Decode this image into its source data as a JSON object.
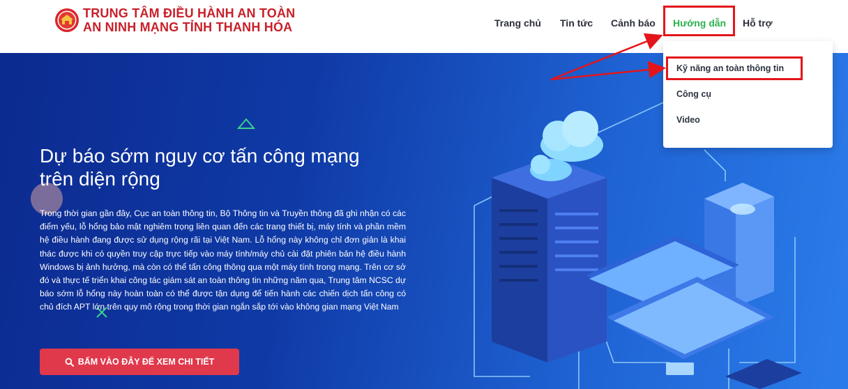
{
  "header": {
    "brand_line1": "TRUNG TÂM ĐIỀU HÀNH AN TOÀN",
    "brand_line2": "AN NINH MẠNG TỈNH THANH HÓA",
    "logo_icon": "thanh-hoa-emblem-icon"
  },
  "nav": {
    "items": [
      {
        "label": "Trang chủ"
      },
      {
        "label": "Tin tức"
      },
      {
        "label": "Cảnh báo"
      },
      {
        "label": "Hướng dẫn",
        "active": true
      },
      {
        "label": "Hỗ trợ"
      }
    ]
  },
  "dropdown": {
    "items": [
      {
        "label": "Kỹ năng an toàn thông tin"
      },
      {
        "label": "Công cụ"
      },
      {
        "label": "Video"
      }
    ]
  },
  "hero": {
    "title_line1": "Dự báo sớm nguy cơ tấn công mạng",
    "title_line2": "trên diện rộng",
    "description": "Trong thời gian gần đây, Cục an toàn thông tin, Bộ Thông tin và Truyền thông đã ghi nhận có các điểm yếu, lỗ hổng bảo mật nghiêm trọng liên quan đến các trang thiết bị, máy tính và phần mềm hệ điều hành đang được sử dụng rộng rãi tại Việt Nam. Lỗ hổng này không chỉ đơn giản là khai thác được khi có quyền truy cập trực tiếp vào máy tính/máy chủ cài đặt phiên bản hệ điều hành Windows bị ảnh hưởng, mà còn có thể tấn công thông qua một máy tính trong mạng. Trên cơ sở đó và thực tế triển khai công tác giám sát an toàn thông tin những năm qua, Trung tâm NCSC dự báo sớm lỗ hổng này hoàn toàn có thể được tận dụng để tiến hành các chiến dịch tấn công có chủ đích APT lớn trên quy mô rộng trong thời gian ngắn sắp tới vào không gian mạng Việt Nam",
    "cta_label": "BẤM VÀO ĐÂY ĐỂ XEM CHI TIẾT",
    "cta_icon": "search-icon"
  },
  "colors": {
    "brand_red": "#c8202a",
    "nav_active": "#2bb24c",
    "annotation_red": "#e3151a",
    "cta_red": "#e0394b",
    "hero_blue": "#0f3aa6"
  }
}
